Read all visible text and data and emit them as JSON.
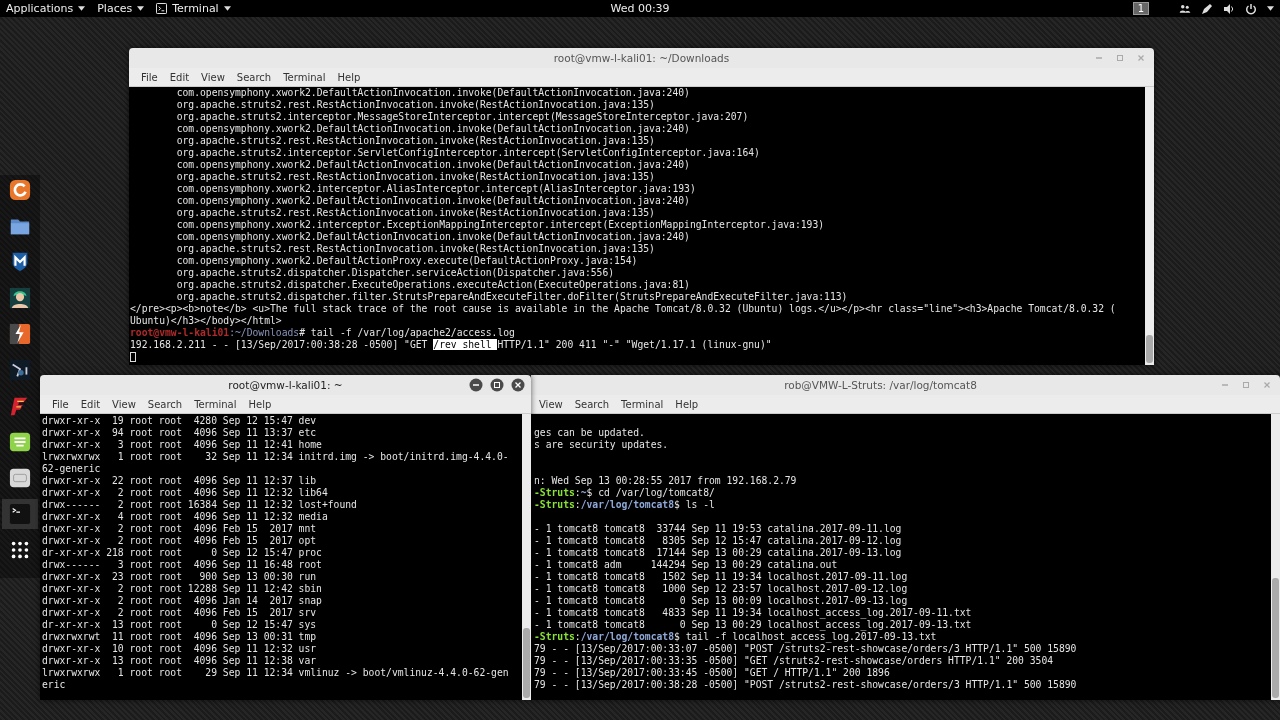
{
  "top_bar": {
    "menus": [
      {
        "label": "Applications",
        "kind": "plain"
      },
      {
        "label": "Places",
        "kind": "plain"
      },
      {
        "label": "Terminal",
        "kind": "app"
      }
    ],
    "clock": "Wed 00:39",
    "workspace": "1"
  },
  "dock": {
    "items": [
      {
        "kind": "swirl",
        "selected": false
      },
      {
        "kind": "folder",
        "selected": false
      },
      {
        "kind": "shield",
        "selected": false
      },
      {
        "kind": "person",
        "selected": false
      },
      {
        "kind": "lightning",
        "selected": false
      },
      {
        "kind": "dark",
        "selected": false
      },
      {
        "kind": "zigzag",
        "selected": false
      },
      {
        "kind": "notes",
        "selected": false
      },
      {
        "kind": "gray",
        "selected": false
      },
      {
        "kind": "terminal",
        "selected": true
      },
      {
        "kind": "grid",
        "selected": false
      }
    ]
  },
  "windows": [
    {
      "title": "root@vmw-l-kali01: ~/Downloads",
      "active": false,
      "cursor": true,
      "menu": [
        "File",
        "Edit",
        "View",
        "Search",
        "Terminal",
        "Help"
      ],
      "blocks": [
        [
          "\tcom.opensymphony.xwork2.DefaultActionInvocation.invoke(DefaultActionInvocation.java:240)",
          "\torg.apache.struts2.rest.RestActionInvocation.invoke(RestActionInvocation.java:135)",
          "\torg.apache.struts2.interceptor.MessageStoreInterceptor.intercept(MessageStoreInterceptor.java:207)",
          "\tcom.opensymphony.xwork2.DefaultActionInvocation.invoke(DefaultActionInvocation.java:240)",
          "\torg.apache.struts2.rest.RestActionInvocation.invoke(RestActionInvocation.java:135)",
          "\torg.apache.struts2.interceptor.ServletConfigInterceptor.intercept(ServletConfigInterceptor.java:164)",
          "\tcom.opensymphony.xwork2.DefaultActionInvocation.invoke(DefaultActionInvocation.java:240)",
          "\torg.apache.struts2.rest.RestActionInvocation.invoke(RestActionInvocation.java:135)",
          "\tcom.opensymphony.xwork2.interceptor.AliasInterceptor.intercept(AliasInterceptor.java:193)",
          "\tcom.opensymphony.xwork2.DefaultActionInvocation.invoke(DefaultActionInvocation.java:240)",
          "\torg.apache.struts2.rest.RestActionInvocation.invoke(RestActionInvocation.java:135)",
          "\tcom.opensymphony.xwork2.interceptor.ExceptionMappingInterceptor.intercept(ExceptionMappingInterceptor.java:193)",
          "\tcom.opensymphony.xwork2.DefaultActionInvocation.invoke(DefaultActionInvocation.java:240)",
          "\torg.apache.struts2.rest.RestActionInvocation.invoke(RestActionInvocation.java:135)",
          "\tcom.opensymphony.xwork2.DefaultActionProxy.execute(DefaultActionProxy.java:154)",
          "\torg.apache.struts2.dispatcher.Dispatcher.serviceAction(Dispatcher.java:556)",
          "\torg.apache.struts2.dispatcher.ExecuteOperations.executeAction(ExecuteOperations.java:81)",
          "\torg.apache.struts2.dispatcher.filter.StrutsPrepareAndExecuteFilter.doFilter(StrutsPrepareAndExecuteFilter.java:113)",
          "</pre><p><b>note</b> <u>The full stack trace of the root cause is available in the Apache Tomcat/8.0.32 (Ubuntu) logs.</u></p><hr class=\"line\"><h3>Apache Tomcat/8.0.32 (",
          "Ubuntu)</h3></body></html>",
          [
            {
              "text": "root@vmw-l-kali01",
              "kind": "root-user"
            },
            {
              "text": ":~/Downloads",
              "kind": "dim-path"
            },
            {
              "text": "# tail -f /var/log/apache2/access.log",
              "kind": "plain"
            }
          ],
          [
            {
              "text": "192.168.2.211 - - [13/Sep/2017:00:38:28 -0500] \"GET ",
              "kind": "plain"
            },
            {
              "text": "/rev_shell ",
              "kind": "selection"
            },
            {
              "text": "HTTP/1.1\" 200 411 \"-\" \"Wget/1.17.1 (linux-gnu)\"",
              "kind": "plain"
            }
          ]
        ]
      ]
    },
    {
      "title": "root@vmw-l-kali01: ~",
      "active": true,
      "menu": [
        "File",
        "Edit",
        "View",
        "Search",
        "Terminal",
        "Help"
      ],
      "blocks": [
        [
          "drwxr-xr-x  19 root root  4280 Sep 12 15:47 dev",
          "drwxr-xr-x  94 root root  4096 Sep 11 13:37 etc",
          "drwxr-xr-x   3 root root  4096 Sep 11 12:41 home",
          "lrwxrwxrwx   1 root root    32 Sep 11 12:34 initrd.img -> boot/initrd.img-4.4.0-",
          "62-generic",
          "drwxr-xr-x  22 root root  4096 Sep 11 12:37 lib",
          "drwxr-xr-x   2 root root  4096 Sep 11 12:32 lib64",
          "drwx------   2 root root 16384 Sep 11 12:32 lost+found",
          "drwxr-xr-x   4 root root  4096 Sep 11 12:32 media",
          "drwxr-xr-x   2 root root  4096 Feb 15  2017 mnt",
          "drwxr-xr-x   2 root root  4096 Feb 15  2017 opt",
          "dr-xr-xr-x 218 root root     0 Sep 12 15:47 proc",
          "drwx------   3 root root  4096 Sep 11 16:48 root",
          "drwxr-xr-x  23 root root   900 Sep 13 00:30 run",
          "drwxr-xr-x   2 root root 12288 Sep 11 12:42 sbin",
          "drwxr-xr-x   2 root root  4096 Jan 14  2017 snap",
          "drwxr-xr-x   2 root root  4096 Feb 15  2017 srv",
          "dr-xr-xr-x  13 root root     0 Sep 12 15:47 sys",
          "drwxrwxrwt  11 root root  4096 Sep 13 00:31 tmp",
          "drwxr-xr-x  10 root root  4096 Sep 11 12:32 usr",
          "drwxr-xr-x  13 root root  4096 Sep 11 12:38 var",
          "lrwxrwxrwx   1 root root    29 Sep 11 12:34 vmlinuz -> boot/vmlinuz-4.4.0-62-gen",
          "eric"
        ]
      ]
    },
    {
      "title": "rob@VMW-L-Struts: /var/log/tomcat8",
      "active": false,
      "menu": [
        "View",
        "Search",
        "Terminal",
        "Help"
      ],
      "blocks": [
        [
          "ges can be updated.",
          "s are security updates."
        ],
        [
          "n: Wed Sep 13 00:28:55 2017 from 192.168.2.79",
          [
            {
              "text": "-Struts",
              "kind": "host-user"
            },
            {
              "text": ":",
              "kind": "plain"
            },
            {
              "text": "~",
              "kind": "path"
            },
            {
              "text": "$ cd /var/log/tomcat8/",
              "kind": "plain"
            }
          ],
          [
            {
              "text": "-Struts",
              "kind": "host-user"
            },
            {
              "text": ":",
              "kind": "plain"
            },
            {
              "text": "/var/log/tomcat8",
              "kind": "path"
            },
            {
              "text": "$ ls -l",
              "kind": "plain"
            }
          ]
        ],
        [
          "- 1 tomcat8 tomcat8  33744 Sep 11 19:53 catalina.2017-09-11.log",
          "- 1 tomcat8 tomcat8   8305 Sep 12 15:47 catalina.2017-09-12.log",
          "- 1 tomcat8 tomcat8  17144 Sep 13 00:29 catalina.2017-09-13.log",
          "- 1 tomcat8 adm     144294 Sep 13 00:29 catalina.out",
          "- 1 tomcat8 tomcat8   1502 Sep 11 19:34 localhost.2017-09-11.log",
          "- 1 tomcat8 tomcat8   1000 Sep 12 23:57 localhost.2017-09-12.log",
          "- 1 tomcat8 tomcat8      0 Sep 13 00:09 localhost.2017-09-13.log",
          "- 1 tomcat8 tomcat8   4833 Sep 11 19:34 localhost_access_log.2017-09-11.txt",
          "- 1 tomcat8 tomcat8      0 Sep 13 00:29 localhost_access_log.2017-09-13.txt",
          [
            {
              "text": "-Struts",
              "kind": "host-user"
            },
            {
              "text": ":",
              "kind": "plain"
            },
            {
              "text": "/var/log/tomcat8",
              "kind": "path"
            },
            {
              "text": "$ tail -f localhost_access_log.2017-09-13.txt",
              "kind": "plain"
            }
          ],
          "79 - - [13/Sep/2017:00:33:07 -0500] \"POST /struts2-rest-showcase/orders/3 HTTP/1.1\" 500 15890",
          "79 - - [13/Sep/2017:00:33:35 -0500] \"GET /struts2-rest-showcase/orders HTTP/1.1\" 200 3504",
          "79 - - [13/Sep/2017:00:33:45 -0500] \"GET / HTTP/1.1\" 200 1896",
          "79 - - [13/Sep/2017:00:38:28 -0500] \"POST /struts2-rest-showcase/orders/3 HTTP/1.1\" 500 15890"
        ]
      ]
    }
  ]
}
